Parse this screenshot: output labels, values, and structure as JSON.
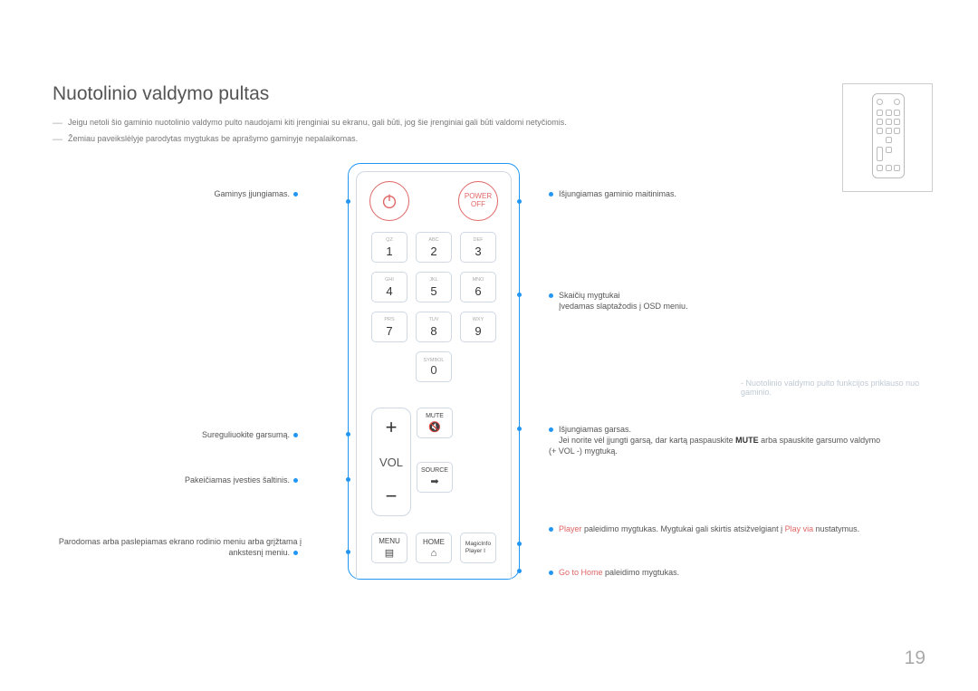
{
  "title": "Nuotolinio valdymo pultas",
  "notes": {
    "n1": "Jeigu netoli šio gaminio nuotolinio valdymo pulto naudojami kiti įrenginiai su ekranu, gali būti, jog šie įrenginiai gali būti valdomi netyčiomis.",
    "n2": "Žemiau paveikslėlyje parodytas mygtukas be aprašymo gaminyje nepalaikomas."
  },
  "left": {
    "power_on": "Gaminys įjungiamas.",
    "volume": "Sureguliuokite garsumą.",
    "source": "Pakeičiamas įvesties šaltinis.",
    "menu": "Parodomas arba paslepiamas ekrano rodinio meniu arba grįžtama į ankstesnį meniu."
  },
  "right": {
    "power_off": "Išjungiamas gaminio maitinimas.",
    "numbers_1": "Skaičių mygtukai",
    "numbers_2": "Įvedamas slaptažodis į OSD meniu.",
    "mute_1": "Išjungiamas garsas.",
    "mute_2a": "Jei norite vėl įjungti garsą, dar kartą paspauskite ",
    "mute_2_bold": "MUTE",
    "mute_2b": " arba spauskite garsumo valdymo (+ VOL -) mygtuką.",
    "player_red": "Player",
    "player_1": " paleidimo mygtukas. Mygtukai gali skirtis atsižvelgiant į ",
    "player_red2": "Play via",
    "player_2": " nustatymus.",
    "home_red": "Go to Home",
    "home": " paleidimo mygtukas."
  },
  "remote": {
    "power_off_label": "POWER\nOFF",
    "keys": {
      "k1": {
        "t": "QZ",
        "n": "1"
      },
      "k2": {
        "t": "ABC",
        "n": "2"
      },
      "k3": {
        "t": "DEF",
        "n": "3"
      },
      "k4": {
        "t": "GHI",
        "n": "4"
      },
      "k5": {
        "t": "JKL",
        "n": "5"
      },
      "k6": {
        "t": "MNO",
        "n": "6"
      },
      "k7": {
        "t": "PRS",
        "n": "7"
      },
      "k8": {
        "t": "TUV",
        "n": "8"
      },
      "k9": {
        "t": "WXY",
        "n": "9"
      },
      "k0": {
        "t": "SYMBOL",
        "n": "0"
      }
    },
    "vol": "VOL",
    "mute": "MUTE",
    "source": "SOURCE",
    "menu": "MENU",
    "home": "HOME",
    "magicinfo": "MagicInfo\nPlayer I"
  },
  "side_note": "Nuotolinio valdymo pulto funkcijos priklauso nuo gaminio.",
  "page": "19"
}
